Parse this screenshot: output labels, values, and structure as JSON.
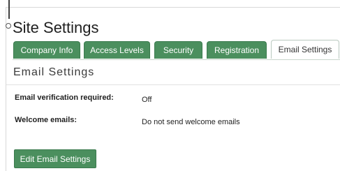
{
  "page": {
    "title": "Site Settings"
  },
  "tabs": [
    {
      "label": "Company Info",
      "active": false
    },
    {
      "label": "Access Levels",
      "active": false
    },
    {
      "label": "Security",
      "active": false
    },
    {
      "label": "Registration",
      "active": false
    },
    {
      "label": "Email Settings",
      "active": true
    }
  ],
  "section": {
    "title": "Email Settings"
  },
  "settings": [
    {
      "label": "Email verification required:",
      "value": "Off"
    },
    {
      "label": "Welcome emails:",
      "value": "Do not send welcome emails"
    }
  ],
  "actions": {
    "edit_label": "Edit Email Settings"
  },
  "colors": {
    "accent": "#4b8f5e",
    "accent_border": "#3a7a4d",
    "active_tab_bg": "#ffffff"
  }
}
